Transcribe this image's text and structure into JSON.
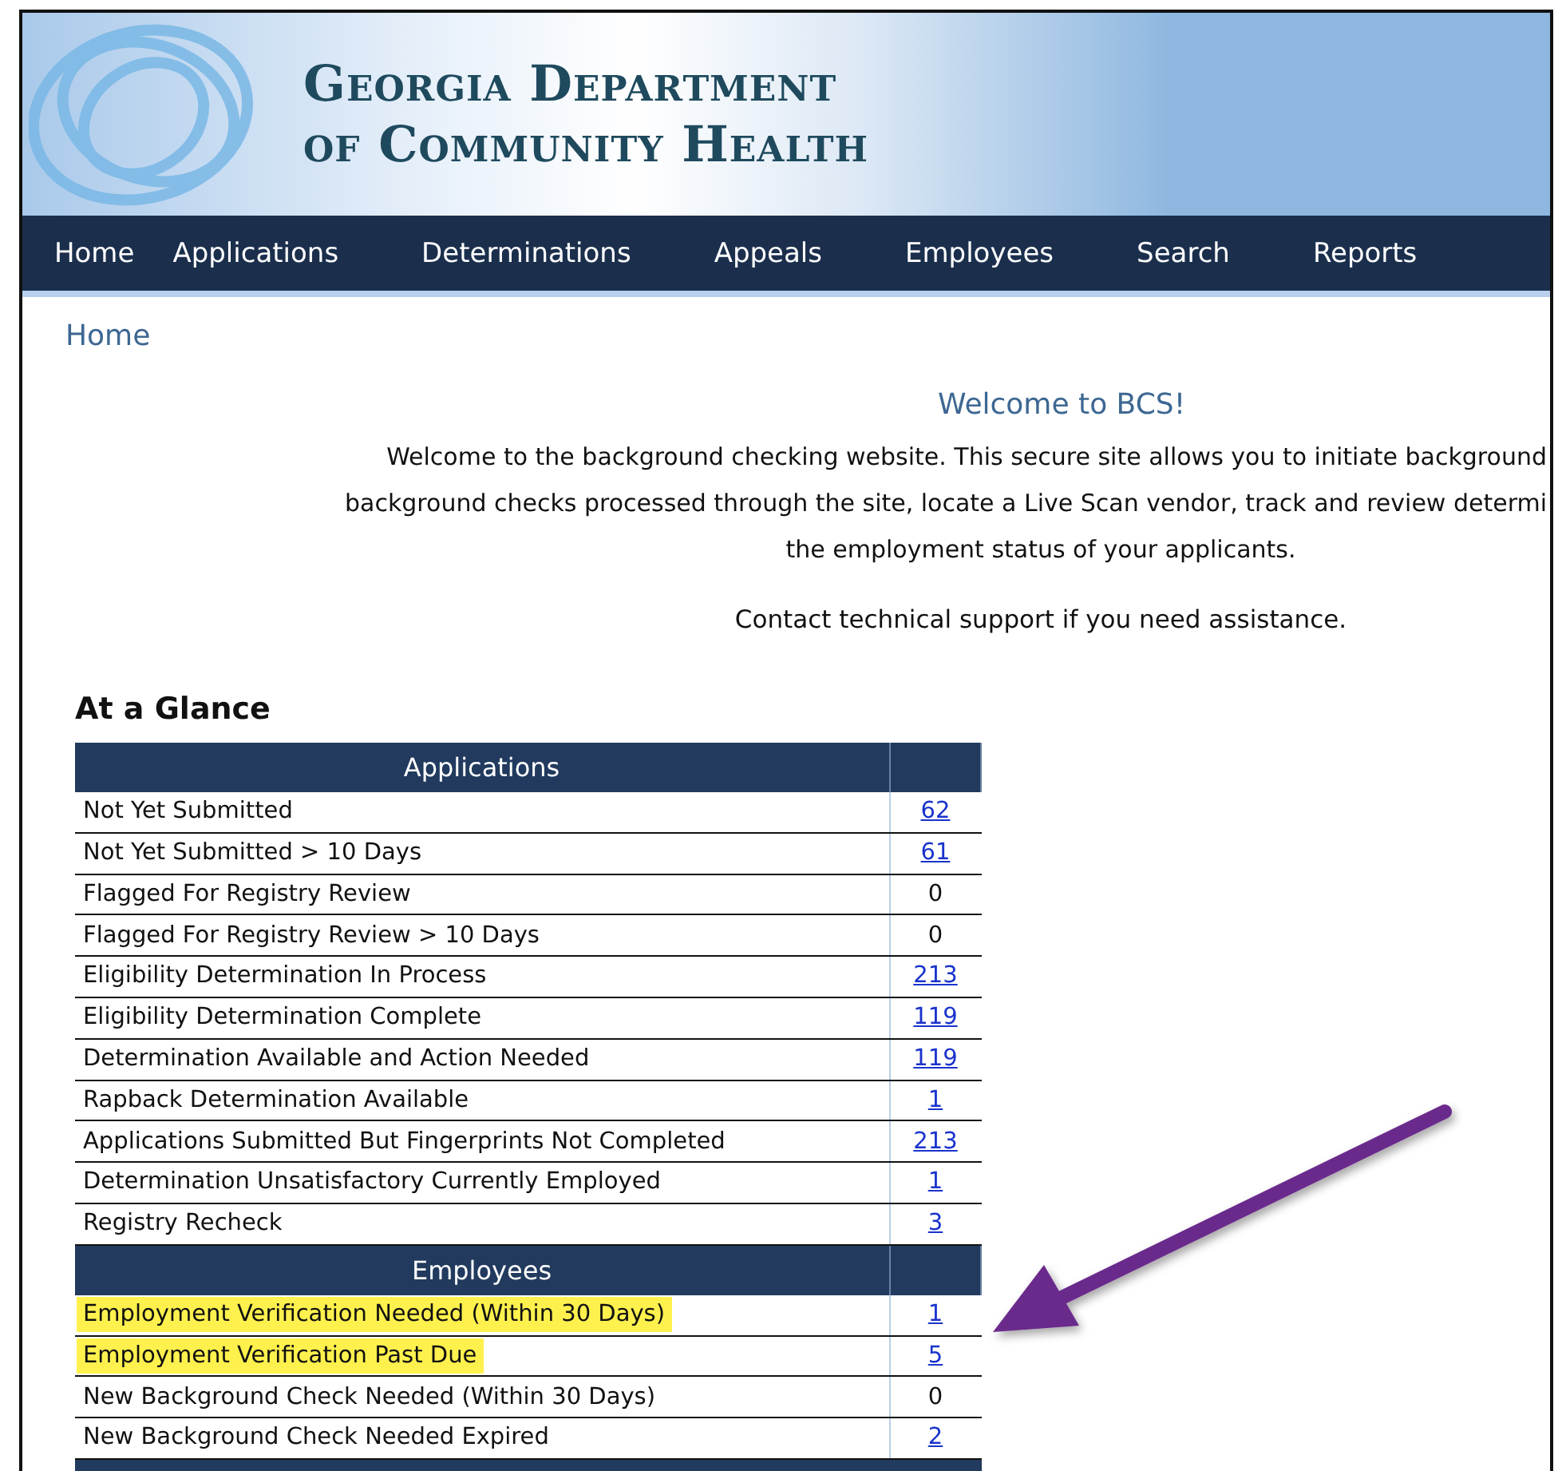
{
  "header": {
    "title_lines": [
      "Georgia Department",
      "of Community Health"
    ]
  },
  "nav": {
    "items": [
      {
        "label": "Home"
      },
      {
        "label": "Applications"
      },
      {
        "label": "Determinations"
      },
      {
        "label": "Appeals"
      },
      {
        "label": "Employees"
      },
      {
        "label": "Search"
      },
      {
        "label": "Reports"
      }
    ]
  },
  "breadcrumb": "Home",
  "welcome": {
    "title": "Welcome to BCS!",
    "lines": [
      "Welcome to the background checking website. This secure site allows you to initiate background",
      "background checks processed through the site, locate a Live Scan vendor, track and review determi",
      "the employment status of your applicants."
    ],
    "contact": "Contact technical support if you need assistance."
  },
  "glance": {
    "title": "At a Glance",
    "sections": [
      {
        "heading": "Applications",
        "rows": [
          {
            "label": "Not Yet Submitted",
            "count": "62",
            "linked": true,
            "highlighted": false
          },
          {
            "label": "Not Yet Submitted > 10 Days",
            "count": "61",
            "linked": true,
            "highlighted": false
          },
          {
            "label": "Flagged For Registry Review",
            "count": "0",
            "linked": false,
            "highlighted": false
          },
          {
            "label": "Flagged For Registry Review > 10 Days",
            "count": "0",
            "linked": false,
            "highlighted": false
          },
          {
            "label": "Eligibility Determination In Process",
            "count": "213",
            "linked": true,
            "highlighted": false
          },
          {
            "label": "Eligibility Determination Complete",
            "count": "119",
            "linked": true,
            "highlighted": false
          },
          {
            "label": "Determination Available and Action Needed",
            "count": "119",
            "linked": true,
            "highlighted": false
          },
          {
            "label": "Rapback Determination Available",
            "count": "1",
            "linked": true,
            "highlighted": false
          },
          {
            "label": "Applications Submitted But Fingerprints Not Completed",
            "count": "213",
            "linked": true,
            "highlighted": false
          },
          {
            "label": "Determination Unsatisfactory Currently Employed",
            "count": "1",
            "linked": true,
            "highlighted": false
          },
          {
            "label": "Registry Recheck",
            "count": "3",
            "linked": true,
            "highlighted": false
          }
        ]
      },
      {
        "heading": "Employees",
        "rows": [
          {
            "label": "Employment Verification Needed (Within 30 Days)",
            "count": "1",
            "linked": true,
            "highlighted": true
          },
          {
            "label": "Employment Verification Past Due",
            "count": "5",
            "linked": true,
            "highlighted": true
          },
          {
            "label": "New Background Check Needed (Within 30 Days)",
            "count": "0",
            "linked": false,
            "highlighted": false
          },
          {
            "label": "New Background Check Needed Expired",
            "count": "2",
            "linked": true,
            "highlighted": false
          }
        ]
      }
    ]
  }
}
